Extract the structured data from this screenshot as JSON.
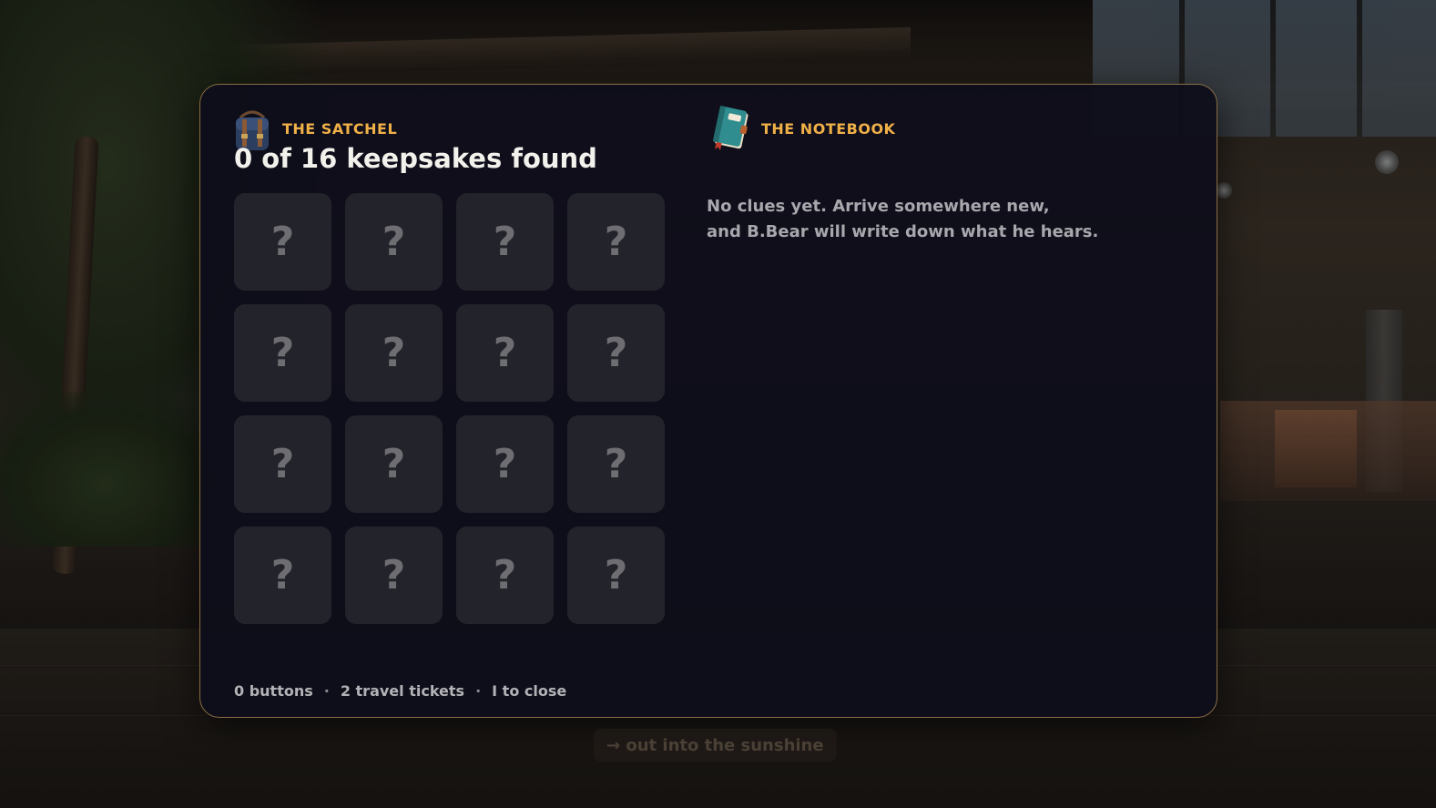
{
  "satchel": {
    "label": "THE SATCHEL",
    "icon": "satchel-icon",
    "found_text": "0 of 16 keepsakes found",
    "slots": [
      "?",
      "?",
      "?",
      "?",
      "?",
      "?",
      "?",
      "?",
      "?",
      "?",
      "?",
      "?",
      "?",
      "?",
      "?",
      "?"
    ]
  },
  "notebook": {
    "label": "THE NOTEBOOK",
    "icon": "notebook-icon",
    "text_line1": "No clues yet. Arrive somewhere new,",
    "text_line2": "and B.Bear will write down what he hears."
  },
  "footer": {
    "buttons": "0 buttons",
    "sep": "·",
    "tickets": "2 travel tickets",
    "close_hint": "I to close"
  },
  "exit_hint": "→ out into the sunshine",
  "colors": {
    "accent": "#f0b048",
    "panel_border": "#8a6d45",
    "panel_bg": "#0e0e1a",
    "slot_bg": "#23232b"
  }
}
